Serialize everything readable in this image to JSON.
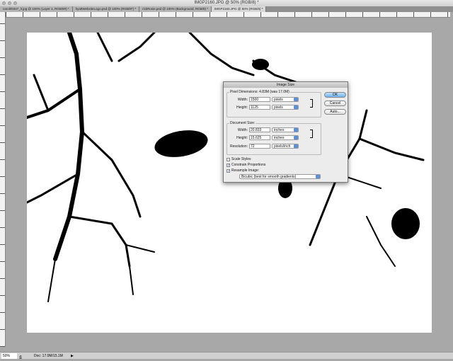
{
  "window": {
    "title": "IMGP2160.JPG @ 50% (RGB/8) *"
  },
  "tabs": [
    {
      "label": "carol00347_lr.jpg @ 100% (Layer 1, RGB/8#) *"
    },
    {
      "label": "hyattWebsiteLogo.psd @ 100% (RGB/8*) *"
    },
    {
      "label": "rickRosie.psd @ 100% (Background, RGB/8) *"
    },
    {
      "label": "IMGP2160.JPG @ 50% (RGB/8) *"
    }
  ],
  "status": {
    "zoom": "50%",
    "doc": "Doc: 17.0M/15.1M"
  },
  "dialog": {
    "title": "Image Size",
    "pixel_dimensions": {
      "label": "Pixel Dimensions:  4.83M (was 17.0M)",
      "width_label": "Width:",
      "width": "1500",
      "width_unit": "pixels",
      "height_label": "Height:",
      "height": "1125",
      "height_unit": "pixels"
    },
    "document_size": {
      "label": "Document Size:",
      "width_label": "Width:",
      "width": "20.833",
      "width_unit": "inches",
      "height_label": "Height:",
      "height": "15.625",
      "height_unit": "inches",
      "resolution_label": "Resolution:",
      "resolution": "72",
      "resolution_unit": "pixels/inch"
    },
    "scale_styles": {
      "label": "Scale Styles",
      "checked": false
    },
    "constrain": {
      "label": "Constrain Proportions",
      "checked": true
    },
    "resample": {
      "label": "Resample Image:",
      "checked": true
    },
    "method": "Bicubic (best for smooth gradients)",
    "buttons": {
      "ok": "OK",
      "cancel": "Cancel",
      "auto": "Auto..."
    }
  }
}
